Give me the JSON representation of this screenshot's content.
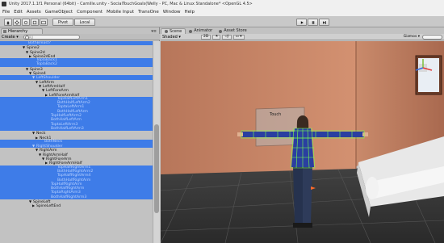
{
  "window": {
    "title": "Unity 2017.1.1f1 Personal (64bit) - Camille.unity - SocialTouchGoals(Welly - PC, Mac & Linux Standalone* <OpenGL 4.5>"
  },
  "menu": [
    "File",
    "Edit",
    "Assets",
    "GameObject",
    "Component",
    "Mobile Input",
    "TransOne",
    "Window",
    "Help"
  ],
  "toolbar": {
    "pivot_label": "Pivot",
    "local_label": "Local",
    "play_icon": "play-icon",
    "pause_icon": "pause-icon",
    "step_icon": "step-icon"
  },
  "hierarchy": {
    "tab_label": "Hierarchy",
    "create_label": "Create",
    "search_placeholder": "All",
    "rows": [
      {
        "indent": 90,
        "label": "BothBreast?",
        "style": "selfade",
        "arrow": ""
      },
      {
        "indent": 88,
        "label": "Spine2",
        "style": "",
        "arrow": "▼"
      },
      {
        "indent": 92,
        "label": "Spine2d",
        "style": "",
        "arrow": "▼"
      },
      {
        "indent": 96,
        "label": "Spine2dEnd",
        "style": "",
        "arrow": "▶"
      },
      {
        "indent": 100,
        "label": "ToplaBack1",
        "style": "selfade",
        "arrow": ""
      },
      {
        "indent": 100,
        "label": "ToplaBack2",
        "style": "selfade",
        "arrow": ""
      },
      {
        "indent": 92,
        "label": "Spine3",
        "style": "",
        "arrow": "▼"
      },
      {
        "indent": 96,
        "label": "Spine4",
        "style": "",
        "arrow": "▼"
      },
      {
        "indent": 100,
        "label": "LeftShoulder",
        "style": "selfade",
        "arrow": "▼"
      },
      {
        "indent": 104,
        "label": "LeftArm",
        "style": "",
        "arrow": "▼"
      },
      {
        "indent": 108,
        "label": "LeftArmHalf",
        "style": "",
        "arrow": "▼"
      },
      {
        "indent": 112,
        "label": "LeftForeArm",
        "style": "",
        "arrow": "▼"
      },
      {
        "indent": 116,
        "label": "LeftForeArmHalf",
        "style": "",
        "arrow": "▶"
      },
      {
        "indent": 126,
        "label": "TopHalfLeftArm1",
        "style": "selfade",
        "arrow": ""
      },
      {
        "indent": 126,
        "label": "BothHalfLeftArm2",
        "style": "selfade",
        "arrow": ""
      },
      {
        "indent": 126,
        "label": "ToptaLeftArm1",
        "style": "selfade",
        "arrow": ""
      },
      {
        "indent": 126,
        "label": "BothHalfLeftArm",
        "style": "selfade",
        "arrow": ""
      },
      {
        "indent": 118,
        "label": "TopHalfLeftArm2",
        "style": "selfade",
        "arrow": ""
      },
      {
        "indent": 118,
        "label": "BothHalfLeftArm",
        "style": "selfade",
        "arrow": ""
      },
      {
        "indent": 118,
        "label": "ToptaLeftArm3",
        "style": "selfade",
        "arrow": ""
      },
      {
        "indent": 118,
        "label": "BothHalfLeftArm3",
        "style": "selfade",
        "arrow": ""
      },
      {
        "indent": 100,
        "label": "Neck",
        "style": "",
        "arrow": "▼"
      },
      {
        "indent": 104,
        "label": "Neck1",
        "style": "",
        "arrow": "▶"
      },
      {
        "indent": 110,
        "label": "BothNeck",
        "style": "selfade",
        "arrow": ""
      },
      {
        "indent": 100,
        "label": "RightShoulder",
        "style": "selfade",
        "arrow": "▼"
      },
      {
        "indent": 104,
        "label": "RightArm",
        "style": "",
        "arrow": "▼"
      },
      {
        "indent": 108,
        "label": "RightArmHalf",
        "style": "",
        "arrow": "▼"
      },
      {
        "indent": 112,
        "label": "RightForeArm",
        "style": "",
        "arrow": "▼"
      },
      {
        "indent": 116,
        "label": "RightForeArmHalf",
        "style": "",
        "arrow": "▶"
      },
      {
        "indent": 126,
        "label": "TopHalfRightArm1",
        "style": "selfade",
        "arrow": ""
      },
      {
        "indent": 126,
        "label": "BothHalfRightArm2",
        "style": "selfade",
        "arrow": ""
      },
      {
        "indent": 126,
        "label": "TopHalfRightArm4",
        "style": "selfade",
        "arrow": ""
      },
      {
        "indent": 126,
        "label": "BothHalfRightArm",
        "style": "selfade",
        "arrow": ""
      },
      {
        "indent": 118,
        "label": "TopHalfRightArm",
        "style": "selfade",
        "arrow": ""
      },
      {
        "indent": 118,
        "label": "BothHalfRightArm",
        "style": "selfade",
        "arrow": ""
      },
      {
        "indent": 118,
        "label": "ToptaRightArm3",
        "style": "selfade",
        "arrow": ""
      },
      {
        "indent": 118,
        "label": "BothHalfRightArm3",
        "style": "selfade",
        "arrow": ""
      },
      {
        "indent": 96,
        "label": "SpineLeft",
        "style": "",
        "arrow": "▼"
      },
      {
        "indent": 100,
        "label": "SpineLeftEnd",
        "style": "",
        "arrow": "▶"
      }
    ]
  },
  "scene": {
    "tabs": [
      {
        "label": "Scene",
        "active": true
      },
      {
        "label": "Animator",
        "active": false
      },
      {
        "label": "Asset Store",
        "active": false
      }
    ],
    "shading_mode": "Shaded",
    "mode_2d": "2D",
    "gizmos_label": "Gizmos",
    "panel_text": "Touch"
  },
  "colors": {
    "selection": "#3e7ce8",
    "wall": "#c88060",
    "floor": "#3a3a3a",
    "mesh_green": "#7cff4a",
    "shirt": "#2a3fa0"
  }
}
